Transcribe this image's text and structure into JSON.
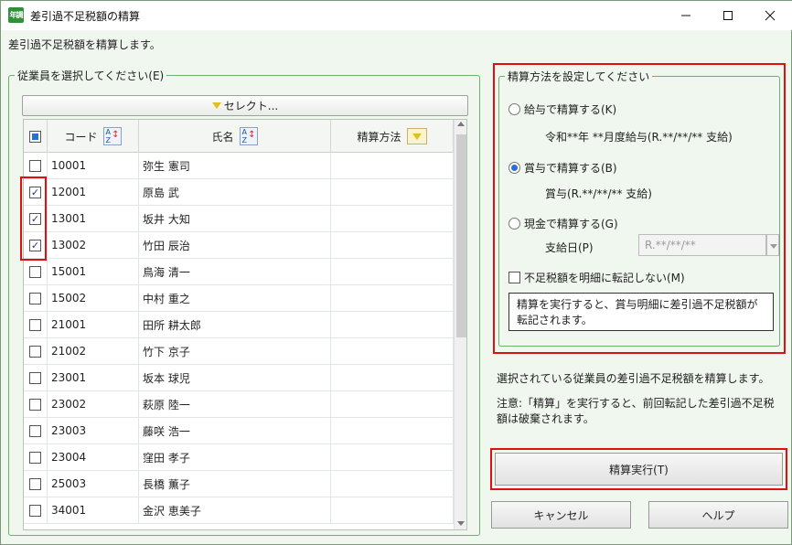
{
  "window": {
    "icon_text": "年調",
    "title": "差引過不足税額の精算"
  },
  "description": "差引過不足税額を精算します。",
  "employee_group": {
    "legend": "従業員を選択してください(E)",
    "select_button_label": "セレクト...",
    "columns": {
      "code": "コード",
      "name": "氏名",
      "method": "精算方法"
    },
    "rows": [
      {
        "checked": false,
        "code": "10001",
        "name": "弥生 憲司",
        "method": ""
      },
      {
        "checked": true,
        "code": "12001",
        "name": "原島 武",
        "method": ""
      },
      {
        "checked": true,
        "code": "13001",
        "name": "坂井 大知",
        "method": ""
      },
      {
        "checked": true,
        "code": "13002",
        "name": "竹田 辰治",
        "method": ""
      },
      {
        "checked": false,
        "code": "15001",
        "name": "鳥海 清一",
        "method": ""
      },
      {
        "checked": false,
        "code": "15002",
        "name": "中村 重之",
        "method": ""
      },
      {
        "checked": false,
        "code": "21001",
        "name": "田所 耕太郎",
        "method": ""
      },
      {
        "checked": false,
        "code": "21002",
        "name": "竹下 京子",
        "method": ""
      },
      {
        "checked": false,
        "code": "23001",
        "name": "坂本 球児",
        "method": ""
      },
      {
        "checked": false,
        "code": "23002",
        "name": "萩原 陸一",
        "method": ""
      },
      {
        "checked": false,
        "code": "23003",
        "name": "藤咲 浩一",
        "method": ""
      },
      {
        "checked": false,
        "code": "23004",
        "name": "窪田 孝子",
        "method": ""
      },
      {
        "checked": false,
        "code": "25003",
        "name": "長橋 薫子",
        "method": ""
      },
      {
        "checked": false,
        "code": "34001",
        "name": "金沢 恵美子",
        "method": ""
      }
    ]
  },
  "settle_group": {
    "legend": "精算方法を設定してください",
    "option_salary": "給与で精算する(K)",
    "option_salary_detail": "令和**年 **月度給与(R.**/**/** 支給)",
    "option_bonus": "賞与で精算する(B)",
    "option_bonus_detail": "賞与(R.**/**/** 支給)",
    "option_cash": "現金で精算する(G)",
    "pay_date_label": "支給日(P)",
    "pay_date_value": "R.**/**/**",
    "no_transfer_label": "不足税額を明細に転記しない(M)",
    "note": "精算を実行すると、賞与明細に差引過不足税額が転記されます。",
    "selected": "bonus"
  },
  "info": {
    "line1": "選択されている従業員の差引過不足税額を精算します。",
    "line2": "注意:「精算」を実行すると、前回転記した差引過不足税額は破棄されます。"
  },
  "buttons": {
    "execute": "精算実行(T)",
    "cancel": "キャンセル",
    "help": "ヘルプ"
  },
  "colors": {
    "highlight": "#e01010",
    "accent": "#2a6fd6",
    "group_border": "#6bb06b"
  }
}
